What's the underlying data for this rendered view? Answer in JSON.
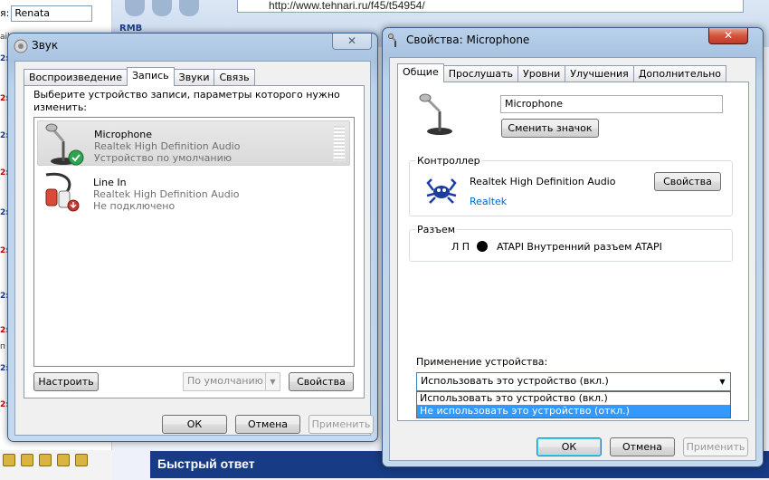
{
  "browser": {
    "url": "http://www.tehnari.ru/f45/t54954/",
    "name_label": "я:",
    "name_value": "Renata",
    "toolbar_label": "RMB",
    "quick_reply": "Быстрый ответ",
    "side_fragments": [
      "ail",
      "2:",
      "2:",
      "2:",
      "2:",
      "2:",
      "2:",
      "2:",
      "2:",
      "2:",
      "п",
      "2:"
    ]
  },
  "sound": {
    "title": "Звук",
    "close": "✕",
    "tabs": [
      "Воспроизведение",
      "Запись",
      "Звуки",
      "Связь"
    ],
    "active_tab": "Запись",
    "instruction": "Выберите устройство записи, параметры которого нужно изменить:",
    "devices": [
      {
        "name": "Microphone",
        "driver": "Realtek High Definition Audio",
        "status": "Устройство по умолчанию"
      },
      {
        "name": "Line In",
        "driver": "Realtek High Definition Audio",
        "status": "Не подключено"
      }
    ],
    "configure_btn": "Настроить",
    "default_btn": "По умолчанию",
    "properties_btn": "Свойства",
    "ok_btn": "ОК",
    "cancel_btn": "Отмена",
    "apply_btn": "Применить"
  },
  "props": {
    "title": "Свойства: Microphone",
    "close": "✕",
    "tabs": [
      "Общие",
      "Прослушать",
      "Уровни",
      "Улучшения",
      "Дополнительно"
    ],
    "active_tab": "Общие",
    "name_value": "Microphone",
    "change_icon_btn": "Сменить значок",
    "controller_label": "Контроллер",
    "controller_name": "Realtek High Definition Audio",
    "controller_vendor": "Realtek",
    "controller_props_btn": "Свойства",
    "jack_label": "Разъем",
    "jack_channels": "Л П",
    "jack_description": "ATAPI Внутренний разъем ATAPI",
    "usage_label": "Применение устройства:",
    "usage_selected": "Использовать это устройство (вкл.)",
    "usage_options": [
      "Использовать это устройство (вкл.)",
      "Не использовать это устройство (откл.)"
    ],
    "usage_highlighted_index": 1,
    "ok_btn": "ОК",
    "cancel_btn": "Отмена",
    "apply_btn": "Применить"
  },
  "colors": {
    "aero_frame": "#b9d1ea",
    "close_red": "#c0392b",
    "highlight": "#3399ff",
    "link": "#0066cc",
    "quick_reply_bar": "#173b84"
  }
}
